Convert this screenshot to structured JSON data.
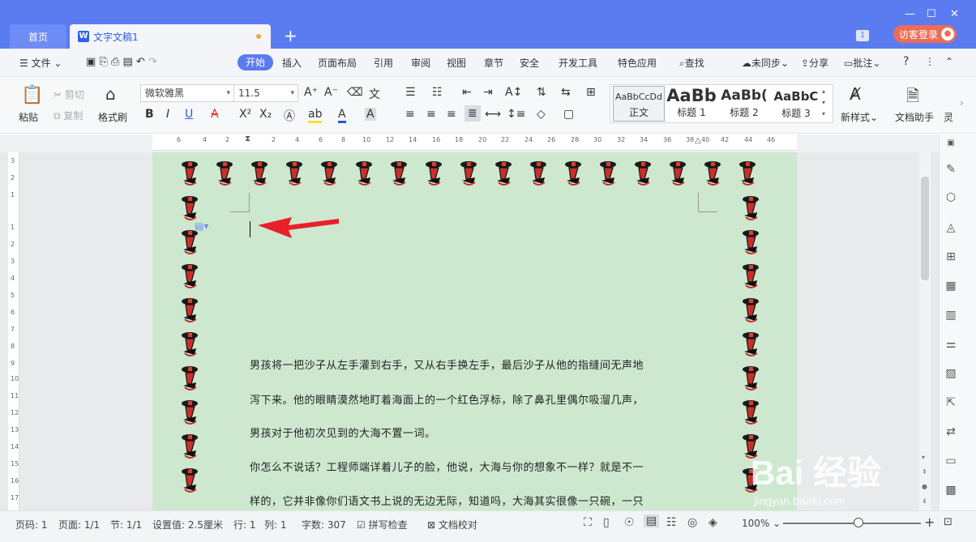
{
  "tabs": {
    "home": "首页",
    "doc": "文字文稿1",
    "new_tab": "+",
    "badge": "1"
  },
  "login": {
    "label": "访客登录"
  },
  "menu": {
    "file": "文件",
    "start": "开始",
    "insert": "插入",
    "layout": "页面布局",
    "reference": "引用",
    "review": "审阅",
    "view": "视图",
    "section": "章节",
    "security": "安全",
    "developer": "开发工具",
    "special": "特色应用",
    "search": "查找",
    "sync": "未同步",
    "share": "分享",
    "comment": "批注",
    "help": "?"
  },
  "ribbon": {
    "paste": "粘贴",
    "cut": "剪切",
    "copy": "复制",
    "format_painter": "格式刷",
    "font_name": "微软雅黑",
    "font_size": "11.5",
    "bold": "B",
    "italic": "I",
    "underline": "U",
    "styles": [
      {
        "preview": "AaBbCcDd",
        "name": "正文"
      },
      {
        "preview": "AaBb",
        "name": "标题 1"
      },
      {
        "preview": "AaBb(",
        "name": "标题 2"
      },
      {
        "preview": "AaBbC",
        "name": "标题 3"
      }
    ],
    "new_style": "新样式",
    "doc_helper": "文档助手",
    "more": "灵"
  },
  "ruler": {
    "numbers": [
      "6",
      "4",
      "2",
      "2",
      "4",
      "6",
      "8",
      "10",
      "12",
      "14",
      "16",
      "18",
      "20",
      "22",
      "24",
      "26",
      "28",
      "30",
      "32",
      "34",
      "36",
      "38",
      "40",
      "42",
      "44",
      "46"
    ],
    "vnumbers": [
      "3",
      "2",
      "1",
      "1",
      "2",
      "3",
      "4",
      "5",
      "6",
      "7",
      "8",
      "9",
      "10",
      "11",
      "12",
      "13",
      "14",
      "15",
      "16",
      "17"
    ]
  },
  "document": {
    "paragraphs": [
      "男孩将一把沙子从左手灌到右手，又从右手换左手，最后沙子从他的指缝间无声地",
      "泻下来。他的眼睛漠然地盯着海面上的一个红色浮标，除了鼻孔里偶尔吸溜几声，",
      "男孩对于他初次见到的大海不置一词。",
      "你怎么不说话？工程师端详着儿子的脸，他说，大海与你的想象不一样？就是不一",
      "样的，它并非像你们语文书上说的无边无际，知道吗，大海其实很像一只碗，一只"
    ],
    "arrow_color": "#e8202a",
    "page_color": "#cde8cf"
  },
  "status": {
    "page_code": "页码: 1",
    "page": "页面: 1/1",
    "section": "节: 1/1",
    "setting": "设置值: 2.5厘米",
    "row": "行: 1",
    "col": "列: 1",
    "words": "字数: 307",
    "spell": "拼写检查",
    "proof": "文档校对",
    "zoom": "100%"
  },
  "watermark": {
    "text": "Bai 经验",
    "url": "jingyan.baidu.com"
  }
}
